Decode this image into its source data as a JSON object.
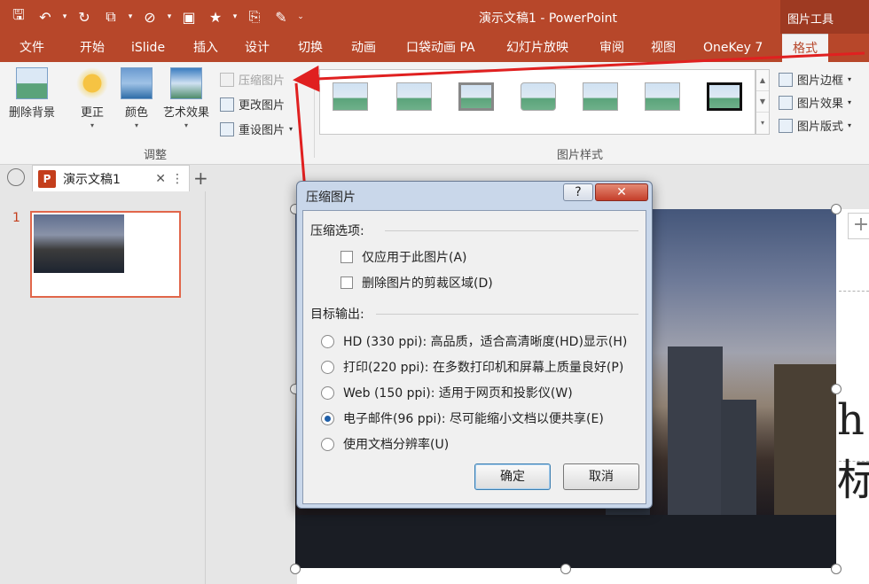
{
  "window": {
    "title": "演示文稿1 - PowerPoint",
    "context_tab_title": "图片工具"
  },
  "tabs": [
    "文件",
    "开始",
    "iSlide",
    "插入",
    "设计",
    "切换",
    "动画",
    "口袋动画 PA",
    "幻灯片放映",
    "审阅",
    "视图",
    "OneKey 7",
    "格式"
  ],
  "ribbon": {
    "remove_bg": "删除背景",
    "corrections": "更正",
    "color": "颜色",
    "artistic": "艺术效果",
    "compress": "压缩图片",
    "change_pic": "更改图片",
    "reset_pic": "重设图片",
    "group_adjust": "调整",
    "group_styles": "图片样式",
    "border": "图片边框",
    "effects": "图片效果",
    "layout": "图片版式"
  },
  "document": {
    "tab_name": "演示文稿1",
    "slide_number": "1",
    "big_char": "h标"
  },
  "dialog": {
    "title": "压缩图片",
    "help": "?",
    "close": "✕",
    "section_options": "压缩选项:",
    "check_apply_only": "仅应用于此图片(A)",
    "check_delete_crop": "删除图片的剪裁区域(D)",
    "section_target": "目标输出:",
    "radios": [
      {
        "label": "HD (330 ppi): 高品质，适合高清晰度(HD)显示(H)",
        "selected": false
      },
      {
        "label": "打印(220 ppi): 在多数打印机和屏幕上质量良好(P)",
        "selected": false
      },
      {
        "label": "Web (150 ppi): 适用于网页和投影仪(W)",
        "selected": false
      },
      {
        "label": "电子邮件(96 ppi): 尽可能缩小文档以便共享(E)",
        "selected": true
      },
      {
        "label": "使用文档分辨率(U)",
        "selected": false
      }
    ],
    "ok": "确定",
    "cancel": "取消"
  },
  "colors": {
    "accent": "#b7472a",
    "arrow": "#e02020"
  }
}
